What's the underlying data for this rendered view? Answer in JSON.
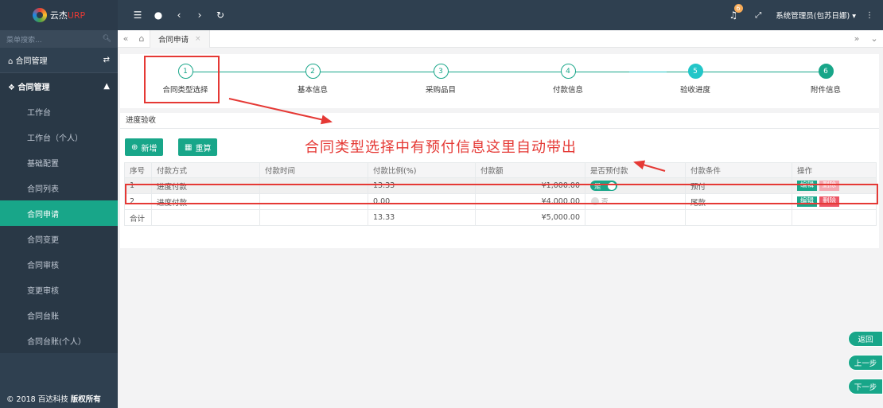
{
  "app": {
    "logo_text": "云杰",
    "logo_brand": "URP",
    "copyright": "© 2018 百达科技",
    "copyright_bold": "版权所有"
  },
  "sidebar": {
    "search_placeholder": "菜单搜索...",
    "top_item": "合同管理",
    "group_label": "合同管理",
    "items": [
      {
        "label": "工作台"
      },
      {
        "label": "工作台（个人）"
      },
      {
        "label": "基础配置"
      },
      {
        "label": "合同列表"
      },
      {
        "label": "合同申请",
        "active": true
      },
      {
        "label": "合同变更"
      },
      {
        "label": "合同审核"
      },
      {
        "label": "变更审核"
      },
      {
        "label": "合同台账"
      },
      {
        "label": "合同台账(个人）"
      }
    ]
  },
  "topbar": {
    "notification_count": "6",
    "user": "系统管理员(包苏日娜) ▾",
    "menu": "⋮"
  },
  "tabs": {
    "active_tab": "合同申请",
    "close": "×"
  },
  "steps": [
    {
      "num": "1",
      "label": "合同类型选择",
      "state": "todo"
    },
    {
      "num": "2",
      "label": "基本信息",
      "state": "todo"
    },
    {
      "num": "3",
      "label": "采购品目",
      "state": "todo"
    },
    {
      "num": "4",
      "label": "付款信息",
      "state": "todo"
    },
    {
      "num": "5",
      "label": "验收进度",
      "state": "current"
    },
    {
      "num": "6",
      "label": "附件信息",
      "state": "done"
    }
  ],
  "panel": {
    "title": "进度验收",
    "add_button": "新增",
    "recalc_button": "重算",
    "annotation": "合同类型选择中有预付信息这里自动带出"
  },
  "table": {
    "columns": [
      "序号",
      "付款方式",
      "付款时间",
      "付款比例(%)",
      "付款额",
      "是否预付款",
      "付款条件",
      "操作"
    ],
    "rows": [
      {
        "no": "1",
        "method": "进度付款",
        "time": "",
        "ratio": "13.33",
        "amount": "¥1,000.00",
        "prepay": "是",
        "prepay_on": true,
        "condition": "预付",
        "edit": "编辑",
        "del": "删除"
      },
      {
        "no": "2",
        "method": "进度付款",
        "time": "",
        "ratio": "0.00",
        "amount": "¥4,000.00",
        "prepay": "否",
        "prepay_on": false,
        "condition": "尾款",
        "edit": "编辑",
        "del": "删除"
      }
    ],
    "total": {
      "label": "合计",
      "ratio": "13.33",
      "amount": "¥5,000.00"
    }
  },
  "actions": {
    "back": "返回",
    "prev": "上一步",
    "next": "下一步"
  },
  "colors": {
    "primary": "#18a689",
    "sidebar": "#2f4050",
    "annotation": "#e53935",
    "danger": "#ed5565"
  }
}
